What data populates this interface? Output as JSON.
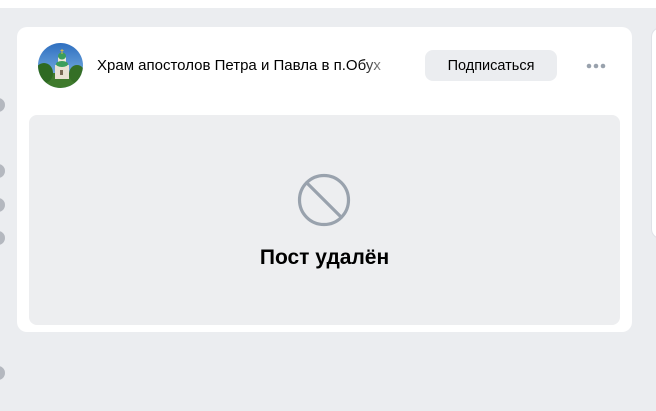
{
  "feed": {
    "post": {
      "author": {
        "name": "Храм апостолов Петра и Павла в п.Обух",
        "avatar_icon": "church-photo-avatar"
      },
      "subscribe_label": "Подписаться",
      "more_icon": "more-horizontal-icon",
      "deleted": {
        "icon": "blocked-circle-icon",
        "message": "Пост удалён"
      }
    }
  },
  "colors": {
    "page_bg": "#ebedf0",
    "card_bg": "#ffffff",
    "deleted_bg": "#edeef0",
    "icon_gray": "#99a2ad"
  }
}
